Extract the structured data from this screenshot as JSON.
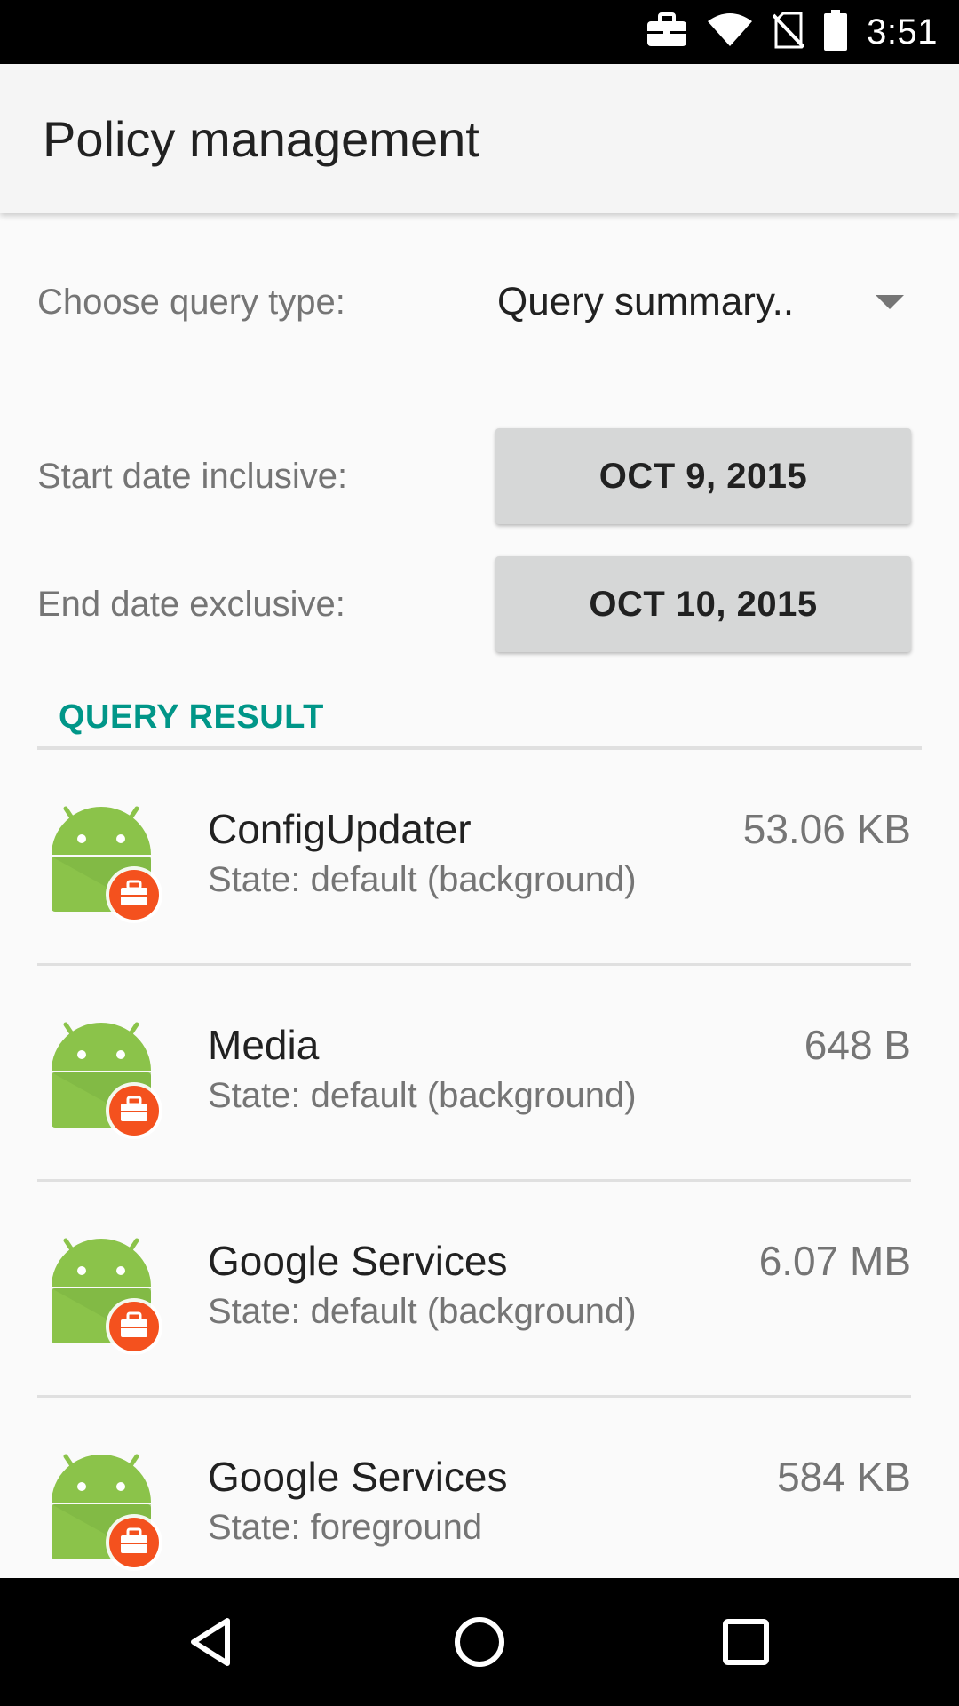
{
  "status_bar": {
    "time": "3:51",
    "icons": [
      "work-briefcase-icon",
      "wifi-icon",
      "no-sim-icon",
      "battery-icon"
    ]
  },
  "app_bar": {
    "title": "Policy management"
  },
  "form": {
    "query_type_label": "Choose query type:",
    "query_type_value": "Query summary..",
    "start_date_label": "Start date inclusive:",
    "start_date_value": "OCT 9, 2015",
    "end_date_label": "End date exclusive:",
    "end_date_value": "OCT 10, 2015"
  },
  "results": {
    "header": "QUERY RESULT",
    "items": [
      {
        "name": "ConfigUpdater",
        "state": "State: default (background)",
        "size": "53.06 KB",
        "icon": "android-work-app-icon"
      },
      {
        "name": "Media",
        "state": "State: default (background)",
        "size": "648 B",
        "icon": "android-work-app-icon"
      },
      {
        "name": "Google Services",
        "state": "State: default (background)",
        "size": "6.07 MB",
        "icon": "android-work-app-icon"
      },
      {
        "name": "Google Services",
        "state": "State: foreground",
        "size": "584 KB",
        "icon": "android-work-app-icon"
      }
    ]
  },
  "nav_bar": {
    "buttons": [
      "back",
      "home",
      "recents"
    ]
  },
  "colors": {
    "accent": "#009688",
    "android_green": "#8bc34a",
    "work_badge": "#f4511e",
    "status_bar": "#000000"
  }
}
